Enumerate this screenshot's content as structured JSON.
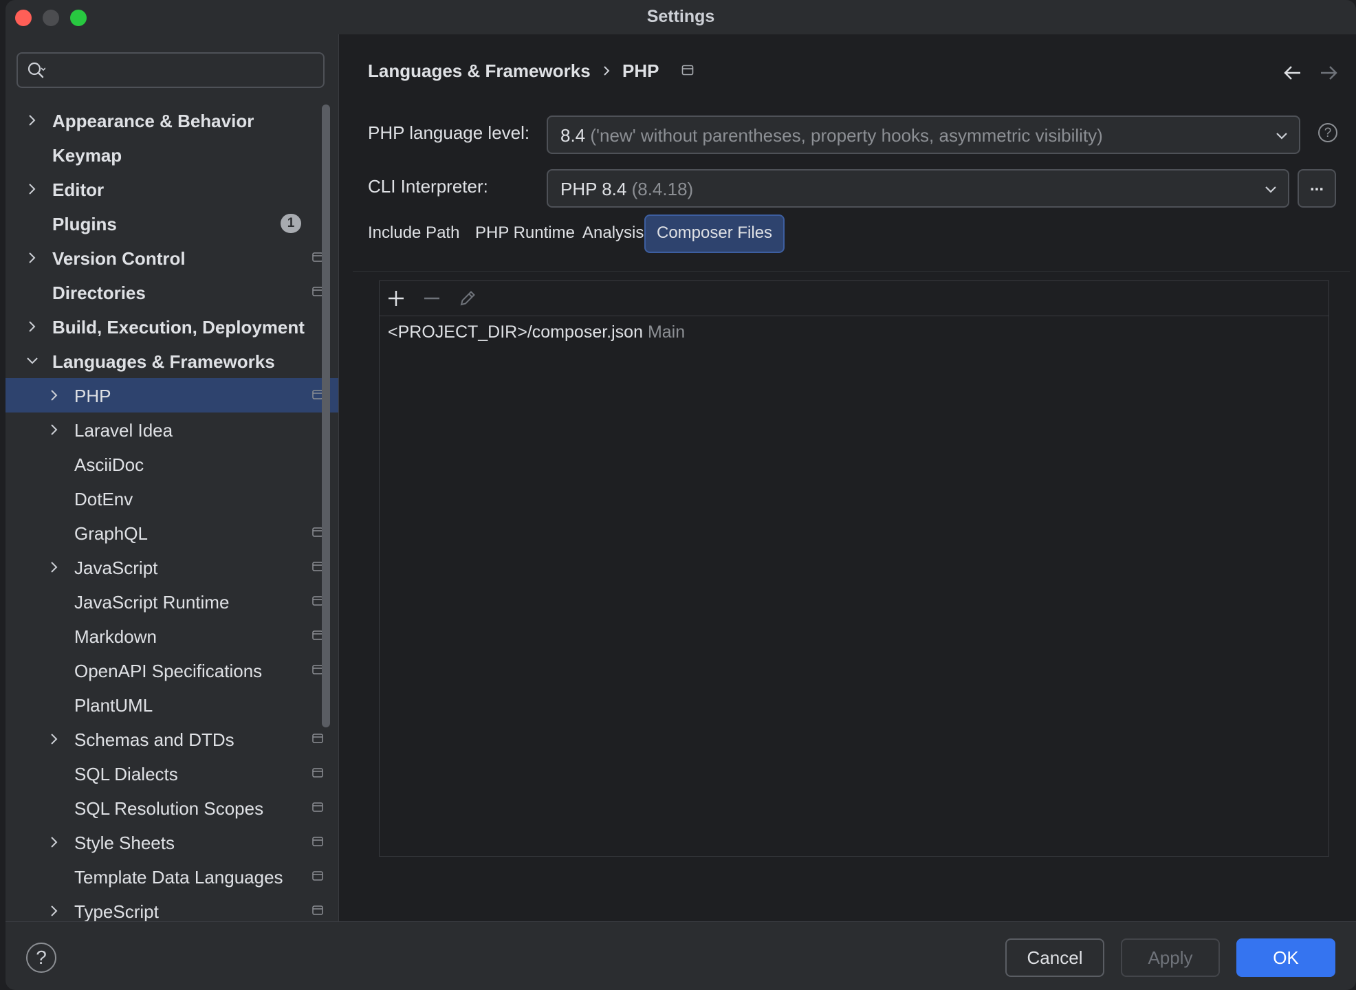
{
  "window": {
    "title": "Settings"
  },
  "search": {
    "value": "",
    "placeholder": ""
  },
  "sidebar": {
    "items": [
      {
        "label": "Appearance & Behavior",
        "bold": true,
        "level": 0,
        "expandable": true,
        "expanded": false
      },
      {
        "label": "Keymap",
        "bold": true,
        "level": 0,
        "expandable": false
      },
      {
        "label": "Editor",
        "bold": true,
        "level": 0,
        "expandable": true,
        "expanded": false
      },
      {
        "label": "Plugins",
        "bold": true,
        "level": 0,
        "expandable": false,
        "badge": "1"
      },
      {
        "label": "Version Control",
        "bold": true,
        "level": 0,
        "expandable": true,
        "expanded": false,
        "project": true
      },
      {
        "label": "Directories",
        "bold": true,
        "level": 0,
        "expandable": false,
        "project": true
      },
      {
        "label": "Build, Execution, Deployment",
        "bold": true,
        "level": 0,
        "expandable": true,
        "expanded": false
      },
      {
        "label": "Languages & Frameworks",
        "bold": true,
        "level": 0,
        "expandable": true,
        "expanded": true
      },
      {
        "label": "PHP",
        "level": 1,
        "expandable": true,
        "expanded": false,
        "project": true,
        "selected": true
      },
      {
        "label": "Laravel Idea",
        "level": 1,
        "expandable": true,
        "expanded": false
      },
      {
        "label": "AsciiDoc",
        "level": 1,
        "expandable": false
      },
      {
        "label": "DotEnv",
        "level": 1,
        "expandable": false
      },
      {
        "label": "GraphQL",
        "level": 1,
        "expandable": false,
        "project": true
      },
      {
        "label": "JavaScript",
        "level": 1,
        "expandable": true,
        "expanded": false,
        "project": true
      },
      {
        "label": "JavaScript Runtime",
        "level": 1,
        "expandable": false,
        "project": true
      },
      {
        "label": "Markdown",
        "level": 1,
        "expandable": false,
        "project": true
      },
      {
        "label": "OpenAPI Specifications",
        "level": 1,
        "expandable": false,
        "project": true
      },
      {
        "label": "PlantUML",
        "level": 1,
        "expandable": false
      },
      {
        "label": "Schemas and DTDs",
        "level": 1,
        "expandable": true,
        "expanded": false,
        "project": true
      },
      {
        "label": "SQL Dialects",
        "level": 1,
        "expandable": false,
        "project": true
      },
      {
        "label": "SQL Resolution Scopes",
        "level": 1,
        "expandable": false,
        "project": true
      },
      {
        "label": "Style Sheets",
        "level": 1,
        "expandable": true,
        "expanded": false,
        "project": true
      },
      {
        "label": "Template Data Languages",
        "level": 1,
        "expandable": false,
        "project": true
      },
      {
        "label": "TypeScript",
        "level": 1,
        "expandable": true,
        "expanded": false,
        "project": true
      }
    ]
  },
  "breadcrumb": {
    "parent": "Languages & Frameworks",
    "current": "PHP"
  },
  "form": {
    "language_level_label": "PHP language level:",
    "language_level_value": "8.4",
    "language_level_hint": "('new' without parentheses, property hooks, asymmetric visibility)",
    "cli_label": "CLI Interpreter:",
    "cli_value": "PHP 8.4",
    "cli_hint": "(8.4.18)",
    "more_label": "..."
  },
  "tabs": [
    {
      "label": "Include Path",
      "active": false
    },
    {
      "label": "PHP Runtime",
      "active": false
    },
    {
      "label": "Analysis",
      "active": false
    },
    {
      "label": "Composer Files",
      "active": true
    }
  ],
  "composer_files": [
    {
      "path": "<PROJECT_DIR>/composer.json",
      "tag": "Main"
    }
  ],
  "footer": {
    "cancel": "Cancel",
    "apply": "Apply",
    "ok": "OK",
    "help": "?"
  },
  "colors": {
    "accent": "#3574f0",
    "selection": "#2e436e",
    "panel": "#2b2d30",
    "background": "#1e1f22"
  },
  "icons": [
    "search-icon",
    "chevron-right-icon",
    "chevron-down-icon",
    "project-scope-icon",
    "arrow-left-icon",
    "arrow-right-icon",
    "help-icon",
    "add-icon",
    "remove-icon",
    "edit-icon"
  ]
}
